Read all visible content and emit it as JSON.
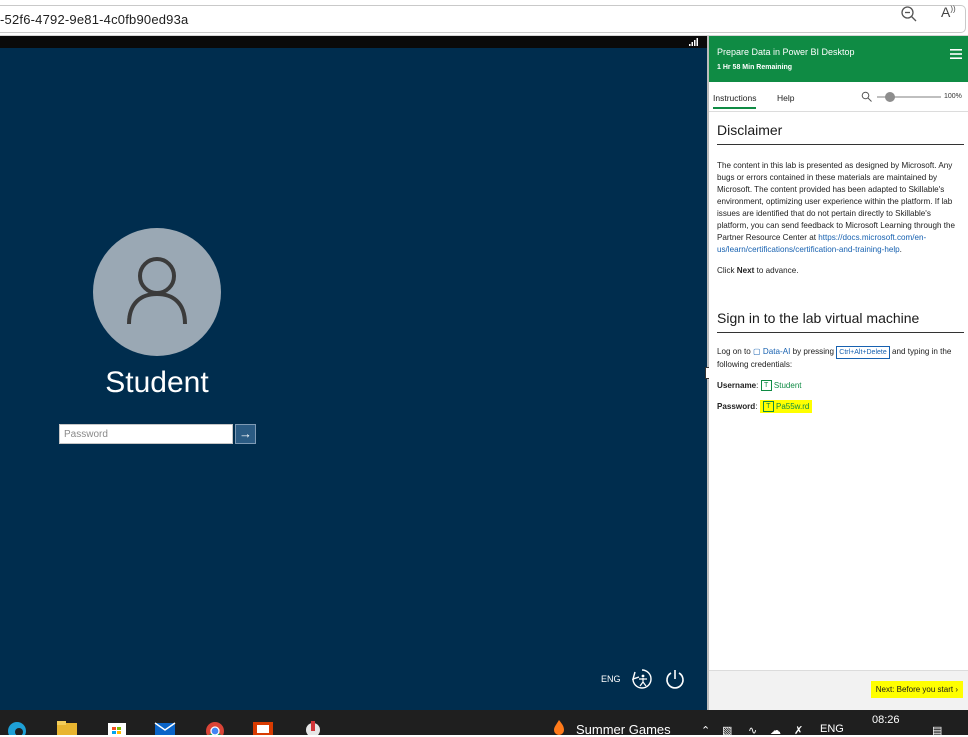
{
  "browser": {
    "url": "-52f6-4792-9e81-4c0fb90ed93a",
    "zoom_icon": "zoom-out-icon",
    "read_aloud_icon": "read-aloud-icon"
  },
  "vm": {
    "username": "Student",
    "password_placeholder": "Password",
    "submit_icon": "arrow-right-icon",
    "language": "ENG",
    "colors": {
      "background": "#002d4e",
      "avatar": "#9aa8b4"
    }
  },
  "panel": {
    "title": "Prepare Data in Power BI Desktop",
    "time_remaining": "1 Hr 58 Min Remaining",
    "tabs": [
      {
        "label": "Instructions"
      },
      {
        "label": "Help"
      }
    ],
    "zoom_percent": "100%",
    "zoom_level": 0.2,
    "sections": {
      "disclaimer_heading": "Disclaimer",
      "disclaimer_text": "The content in this lab is presented as designed by Microsoft. Any bugs or errors contained in these materials are maintained by Microsoft. The content provided has been adapted to Skillable's environment, optimizing user experience within the platform. If lab issues are identified that do not pertain directly to Skillable's platform, you can send feedback to Microsoft Learning through the Partner Resource Center at ",
      "disclaimer_link": "https://docs.microsoft.com/en-us/learn/certifications/certification-and-training-help",
      "disclaimer_end": ".",
      "click_prefix": "Click ",
      "click_bold": "Next",
      "click_suffix": " to advance.",
      "signin_heading": "Sign in to the lab virtual machine",
      "logon_prefix": "Log on to ",
      "vm_name": "Data-AI",
      "logon_mid": " by pressing ",
      "key_combo": "Ctrl+Alt+Delete",
      "logon_suffix": " and typing in the following credentials:",
      "username_label": "Username",
      "username_value": "Student",
      "password_label": "Password",
      "password_value": "Pa55w.rd",
      "type_icon_letter": "T"
    },
    "next_button": "Next: Before you start",
    "colors": {
      "header": "#0f8b44",
      "link": "#1761b0",
      "highlight": "#ffff00"
    }
  },
  "taskbar": {
    "news_label": "Summer Games",
    "language": "ENG",
    "time": "08:26",
    "icons": [
      "edge-icon",
      "file-explorer-icon",
      "store-icon",
      "mail-icon",
      "chrome-icon",
      "office-icon",
      "app-icon"
    ]
  }
}
